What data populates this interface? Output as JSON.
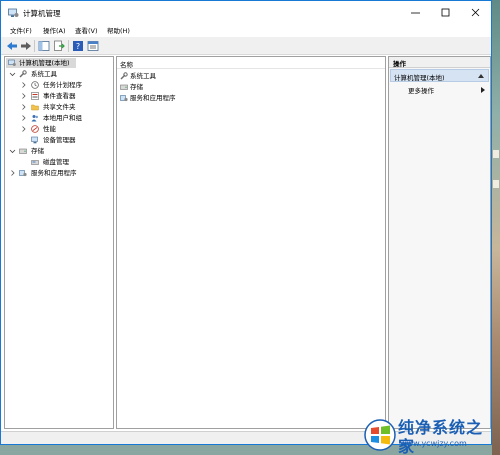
{
  "window": {
    "title": "计算机管理"
  },
  "titlebar": {
    "icons": [
      "minimize-icon",
      "maximize-icon",
      "close-icon"
    ]
  },
  "menubar": {
    "items": [
      "文件(F)",
      "操作(A)",
      "查看(V)",
      "帮助(H)"
    ]
  },
  "toolbar": {
    "icons": [
      "back-arrow-icon",
      "forward-arrow-icon",
      "console-tree-icon",
      "export-list-icon",
      "help-icon",
      "properties-icon"
    ]
  },
  "tree": {
    "root": "计算机管理(本地)",
    "system_tools": "系统工具",
    "task_scheduler": "任务计划程序",
    "event_viewer": "事件查看器",
    "shared_folders": "共享文件夹",
    "local_users": "本地用户和组",
    "performance": "性能",
    "device_manager": "设备管理器",
    "storage": "存储",
    "disk_management": "磁盘管理",
    "services": "服务和应用程序"
  },
  "center": {
    "column_name": "名称",
    "items": [
      "系统工具",
      "存储",
      "服务和应用程序"
    ]
  },
  "actions": {
    "header": "操作",
    "section": "计算机管理(本地)",
    "more": "更多操作"
  },
  "watermark": {
    "title": "纯净系统之家",
    "url": "www.ycwjzy.com"
  },
  "colors": {
    "accent": "#1779d3",
    "selection": "#d9d9d9",
    "actions_section": "#d6e3f2"
  }
}
